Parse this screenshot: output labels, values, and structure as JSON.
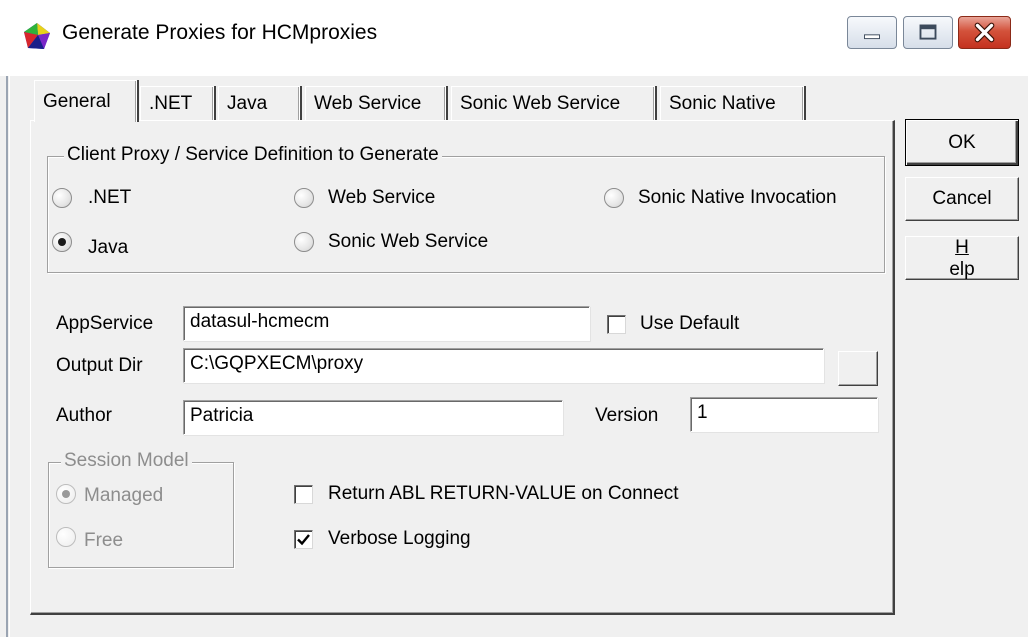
{
  "window": {
    "title": "Generate Proxies for HCMproxies",
    "icon": "multicolor-gem-icon"
  },
  "tabs": [
    {
      "label": "General",
      "active": true
    },
    {
      "label": ".NET"
    },
    {
      "label": "Java"
    },
    {
      "label": "Web Service"
    },
    {
      "label": "Sonic Web Service"
    },
    {
      "label": "Sonic Native"
    }
  ],
  "client_proxy_group": {
    "legend": "Client Proxy / Service Definition to Generate",
    "options": [
      {
        "label": ".NET",
        "checked": false
      },
      {
        "label": "Web Service",
        "checked": false
      },
      {
        "label": "Sonic Native Invocation",
        "checked": false
      },
      {
        "label": "Java",
        "checked": true
      },
      {
        "label": "Sonic Web Service",
        "checked": false
      }
    ]
  },
  "fields": {
    "appservice_label": "AppService",
    "appservice_value": "datasul-hcmecm",
    "use_default_label": "Use Default",
    "use_default_checked": false,
    "output_dir_label": "Output Dir",
    "output_dir_value": "C:\\GQPXECM\\proxy",
    "browse_label": "...",
    "author_label": "Author",
    "author_value": "Patricia",
    "version_label": "Version",
    "version_value": "1"
  },
  "session_model": {
    "legend": "Session Model",
    "options": [
      {
        "label": "Managed",
        "checked": true
      },
      {
        "label": "Free",
        "checked": false
      }
    ]
  },
  "options": {
    "return_abl_label": "Return ABL RETURN-VALUE on Connect",
    "return_abl_checked": false,
    "verbose_label": "Verbose Logging",
    "verbose_checked": true
  },
  "buttons": {
    "ok": "OK",
    "cancel": "Cancel",
    "help_first": "H",
    "help_rest": "elp"
  }
}
